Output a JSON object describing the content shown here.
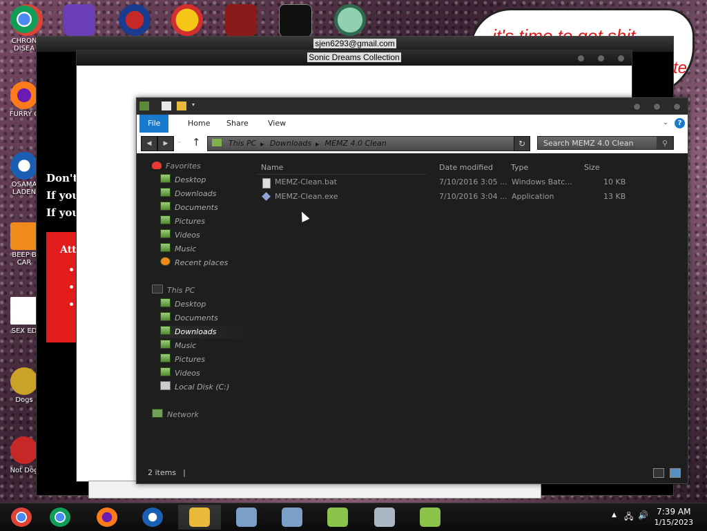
{
  "desktop": {
    "icons": [
      {
        "label": "CHRON\nDISEA",
        "color": "#4a8af4"
      },
      {
        "label": "FURRY C",
        "color": "#ff7a1a"
      },
      {
        "label": "OSAMA\nLADEN",
        "color": "#1a5fb4"
      },
      {
        "label": "BEEP B\nCAR",
        "color": "#f08a1a"
      },
      {
        "label": "SEX ED",
        "color": "#2e7d32"
      },
      {
        "label": "Dogs",
        "color": "#c9a227"
      },
      {
        "label": "Not Dog",
        "color": "#c62828"
      }
    ],
    "speech_text_1": "it's time to get shit",
    "speech_text_2": "te"
  },
  "memz_window": {
    "title": "sjen6293@gmail.com",
    "lines": [
      "Don't",
      "If you",
      "If you"
    ],
    "panel_heading": "Att"
  },
  "sonic_window": {
    "title": "Sonic Dreams Collection"
  },
  "explorer": {
    "ribbon_tabs": [
      "File",
      "Home",
      "Share",
      "View"
    ],
    "address": [
      "This PC",
      "Downloads",
      "MEMZ 4.0 Clean"
    ],
    "search_placeholder": "Search MEMZ 4.0 Clean",
    "nav": {
      "favorites_label": "Favorites",
      "favorites": [
        "Desktop",
        "Downloads",
        "Documents",
        "Pictures",
        "Videos",
        "Music",
        "Recent places"
      ],
      "thispc_label": "This PC",
      "thispc": [
        "Desktop",
        "Documents",
        "Downloads",
        "Music",
        "Pictures",
        "Videos",
        "Local Disk (C:)"
      ],
      "network_label": "Network",
      "selected": "Downloads"
    },
    "columns": [
      "Name",
      "Date modified",
      "Type",
      "Size"
    ],
    "files": [
      {
        "name": "MEMZ-Clean.bat",
        "date": "7/10/2016 3:05 ...",
        "type": "Windows Batc...",
        "size": "10 KB"
      },
      {
        "name": "MEMZ-Clean.exe",
        "date": "7/10/2016 3:04 ...",
        "type": "Application",
        "size": "13 KB"
      }
    ],
    "status": "2 items"
  },
  "taskbar": {
    "apps": [
      "chrome-pinned",
      "chrome",
      "firefox",
      "obama",
      "file-explorer",
      "network-setup",
      "network-setup-2",
      "sonic",
      "monitor",
      "sonic-2"
    ],
    "active_app": "file-explorer",
    "time": "7:39 AM",
    "date": "1/15/2023"
  },
  "colors": {
    "accent": "#1979ca",
    "explorer_bg": "#1e1e1e",
    "red_panel": "#e21b1b"
  }
}
